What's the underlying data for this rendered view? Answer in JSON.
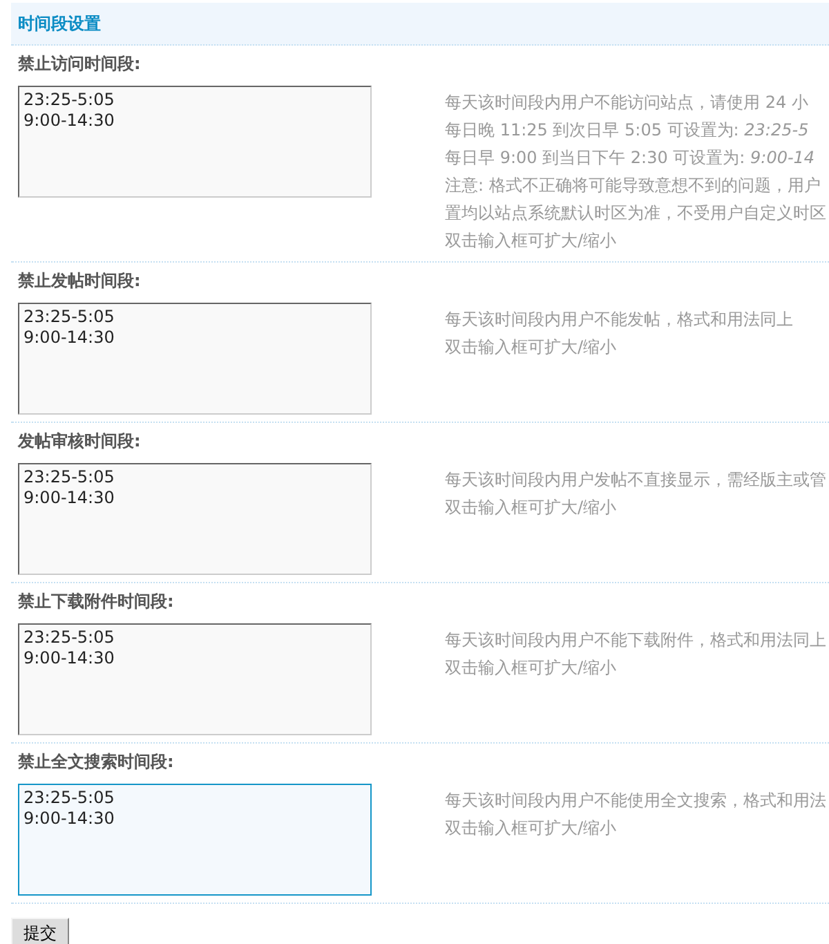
{
  "header": {
    "title": "时间段设置"
  },
  "sections": [
    {
      "label": "禁止访问时间段:",
      "value": "23:25-5:05\n9:00-14:30",
      "focused": false,
      "description": [
        "每天该时间段内用户不能访问站点，请使用 24 小",
        "每日晚 11:25 到次日早 5:05 可设置为: *23:25-5*",
        "每日早 9:00 到当日下午 2:30 可设置为: *9:00-14*",
        "注意: 格式不正确将可能导致意想不到的问题，用户",
        "置均以站点系统默认时区为准，不受用户自定义时区",
        "双击输入框可扩大/缩小"
      ]
    },
    {
      "label": "禁止发帖时间段:",
      "value": "23:25-5:05\n9:00-14:30",
      "focused": false,
      "description": [
        "每天该时间段内用户不能发帖，格式和用法同上",
        "双击输入框可扩大/缩小"
      ]
    },
    {
      "label": "发帖审核时间段:",
      "value": "23:25-5:05\n9:00-14:30",
      "focused": false,
      "description": [
        "每天该时间段内用户发帖不直接显示，需经版主或管",
        "双击输入框可扩大/缩小"
      ]
    },
    {
      "label": "禁止下载附件时间段:",
      "value": "23:25-5:05\n9:00-14:30",
      "focused": false,
      "description": [
        "每天该时间段内用户不能下载附件，格式和用法同上",
        "双击输入框可扩大/缩小"
      ]
    },
    {
      "label": "禁止全文搜索时间段:",
      "value": "23:25-5:05\n9:00-14:30",
      "focused": true,
      "description": [
        "每天该时间段内用户不能使用全文搜索，格式和用法",
        "双击输入框可扩大/缩小"
      ]
    }
  ],
  "submit_button": "提交"
}
